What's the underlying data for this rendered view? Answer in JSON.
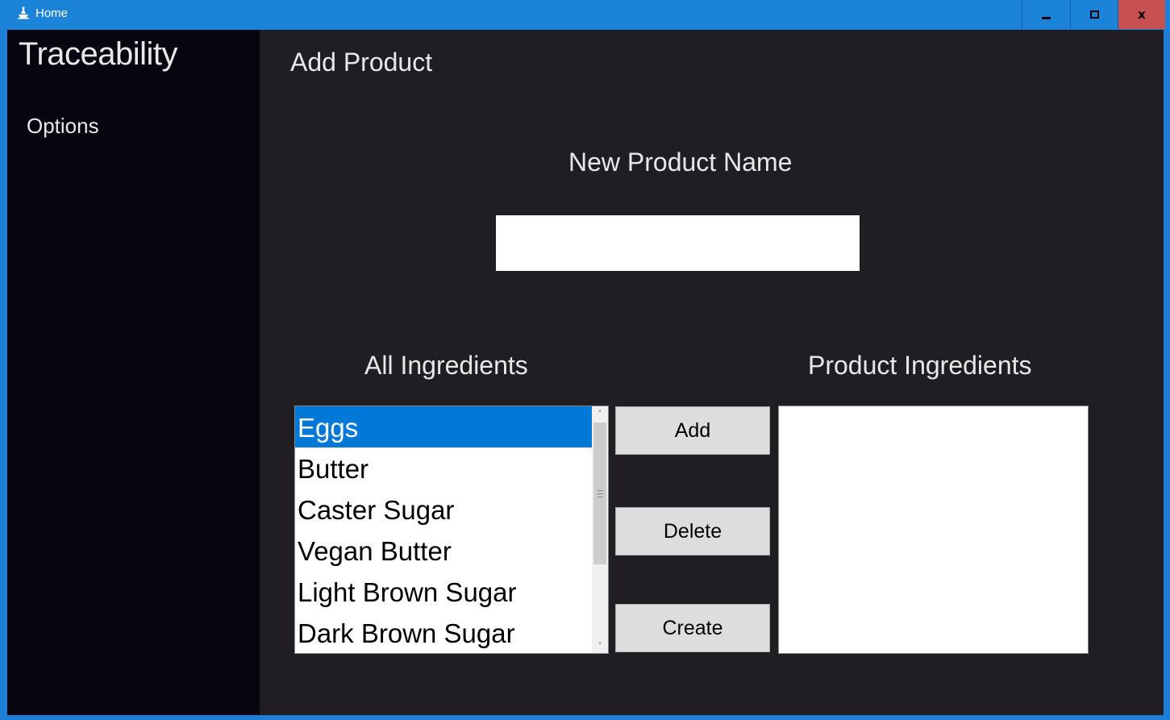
{
  "window": {
    "title": "Home",
    "controls": {
      "minimize": "minimize",
      "maximize": "maximize",
      "close": "x"
    },
    "colors": {
      "titlebar": "#1b84d9",
      "close": "#c75050"
    }
  },
  "sidebar": {
    "app_title": "Traceability",
    "items": [
      {
        "label": "Options"
      }
    ]
  },
  "main": {
    "page_title": "Add Product",
    "name_label": "New Product Name",
    "name_input": {
      "value": "",
      "placeholder": ""
    },
    "all_ingredients_label": "All Ingredients",
    "product_ingredients_label": "Product Ingredients",
    "all_ingredients": [
      {
        "label": "Eggs",
        "selected": true
      },
      {
        "label": "Butter"
      },
      {
        "label": "Caster Sugar"
      },
      {
        "label": "Vegan Butter"
      },
      {
        "label": "Light Brown Sugar"
      },
      {
        "label": "Dark Brown Sugar"
      }
    ],
    "product_ingredients": [],
    "buttons": {
      "add": "Add",
      "delete": "Delete",
      "create": "Create"
    },
    "colors": {
      "selection": "#0078d7",
      "background": "#201e23",
      "sidebar": "#07050f"
    }
  }
}
